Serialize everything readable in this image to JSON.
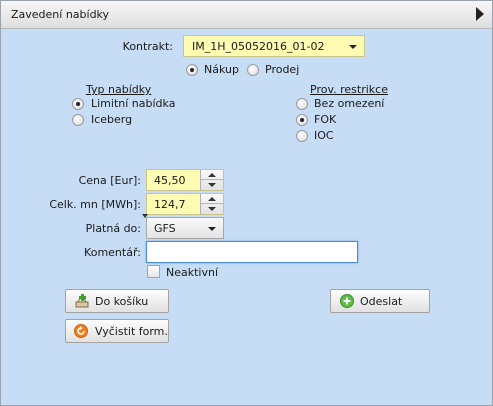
{
  "panel": {
    "title": "Zavedení nabídky"
  },
  "contract": {
    "label": "Kontrakt:",
    "value": "IM_1H_05052016_01-02"
  },
  "side": {
    "options": [
      "Nákup",
      "Prodej"
    ],
    "selected": "Nákup"
  },
  "offer_type": {
    "label": "Typ nabídky",
    "options": [
      "Limitní nabídka",
      "Iceberg"
    ],
    "selected": "Limitní nabídka"
  },
  "restriction": {
    "label": "Prov. restrikce",
    "options": [
      "Bez omezení",
      "FOK",
      "IOC"
    ],
    "selected": "FOK"
  },
  "price": {
    "label": "Cena [Eur]:",
    "value": "45,50"
  },
  "quantity": {
    "label": "Celk. mn [MWh]:",
    "value": "124,7"
  },
  "valid": {
    "label": "Platná do:",
    "value": "GFS"
  },
  "comment": {
    "label": "Komentář:",
    "value": ""
  },
  "inactive": {
    "label": "Neaktivní",
    "checked": false
  },
  "buttons": {
    "basket": "Do košíku",
    "send": "Odeslat",
    "clear": "Vyčistit form."
  },
  "icons": {
    "basket": "basket-add-icon",
    "send": "plus-circle-icon",
    "clear": "refresh-icon"
  },
  "colors": {
    "panel_bg": "#c7dcf5",
    "field_bg": "#fffbb2",
    "focus_border": "#4a8fd6",
    "send_icon": "#5fba46",
    "clear_icon": "#f0801e"
  }
}
